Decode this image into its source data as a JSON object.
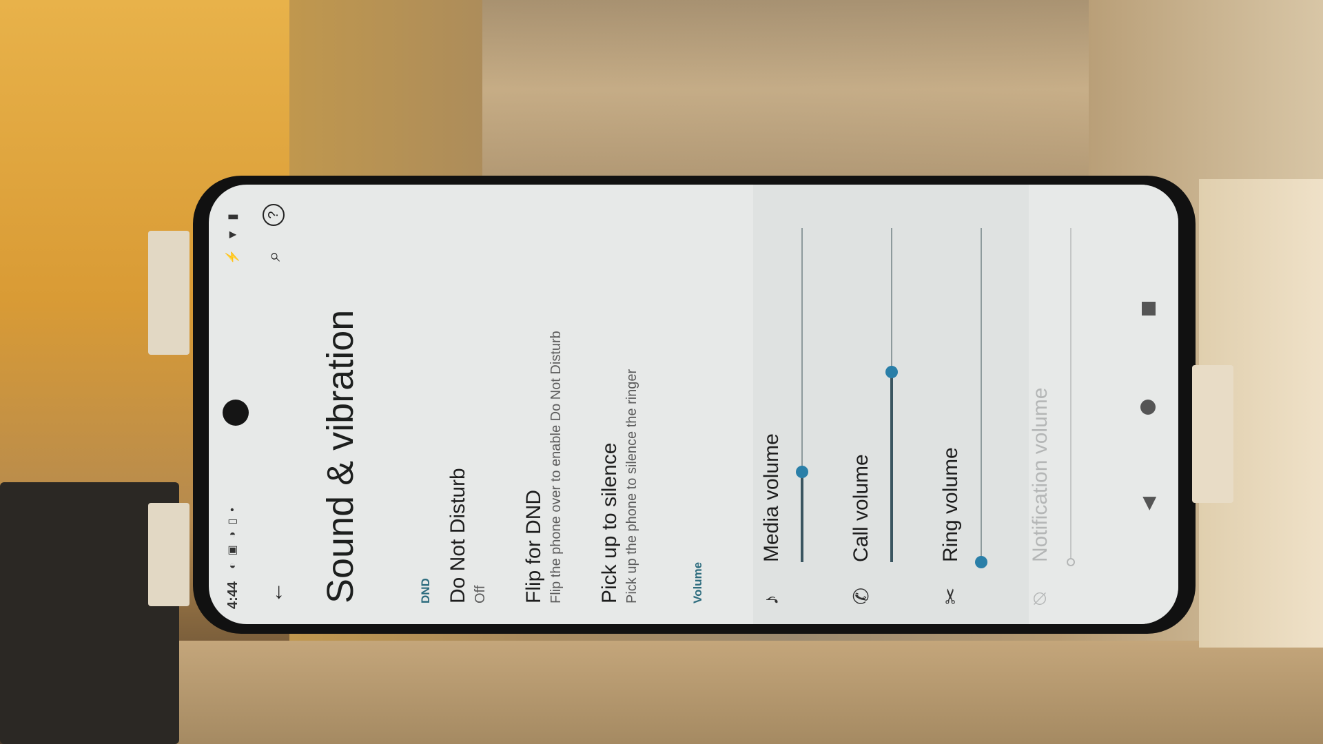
{
  "status_bar": {
    "time": "4:44",
    "dot": "•"
  },
  "app_bar": {
    "back_icon": "arrow-back-icon",
    "search_icon": "search-icon",
    "help_icon": "help-icon",
    "help_glyph": "?"
  },
  "page": {
    "title": "Sound & vibration"
  },
  "dnd": {
    "section_label": "DND",
    "dnd_title": "Do Not Disturb",
    "dnd_status": "Off",
    "flip_title": "Flip for DND",
    "flip_sub": "Flip the phone over to enable Do Not Disturb",
    "pickup_title": "Pick up to silence",
    "pickup_sub": "Pick up the phone to silence the ringer"
  },
  "volume": {
    "section_label": "Volume",
    "media": {
      "label": "Media volume",
      "level": 0.27
    },
    "call": {
      "label": "Call volume",
      "level": 0.57
    },
    "ring": {
      "label": "Ring volume",
      "level": 0.0
    },
    "notification": {
      "label": "Notification volume",
      "level": 0.0
    }
  },
  "colors": {
    "accent": "#2a7fa8",
    "section_header": "#2d6c7e",
    "screen_bg": "#e7e9e8"
  }
}
